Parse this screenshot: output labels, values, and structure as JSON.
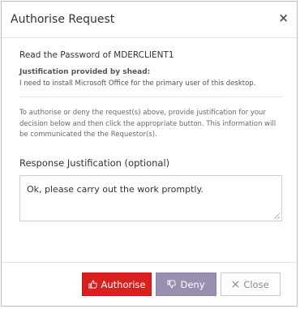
{
  "dialog": {
    "title": "Authorise Request",
    "close_glyph": "×"
  },
  "request": {
    "line": "Read the Password of MDERCLIENT1",
    "justification_label": "Justification provided by shead:",
    "justification_text": "I need to install Microsoft Office for the primary user of this desktop."
  },
  "info_text": "To authorise or deny the request(s) above, provide justification for your decision below and then click the appropriate button. This information will be communicated the the Requestor(s).",
  "response": {
    "label": "Response Justification (optional)",
    "value": "Ok, please carry out the work promptly."
  },
  "buttons": {
    "authorise_label": "Authorise",
    "authorise_icon": "thumbs-up-icon",
    "deny_label": "Deny",
    "deny_icon": "thumbs-down-icon",
    "close_label": "Close",
    "close_icon": "close-icon"
  },
  "colors": {
    "authorise": "#d9201f",
    "deny": "#9a8fb0",
    "close_border": "#c9c9c9"
  }
}
